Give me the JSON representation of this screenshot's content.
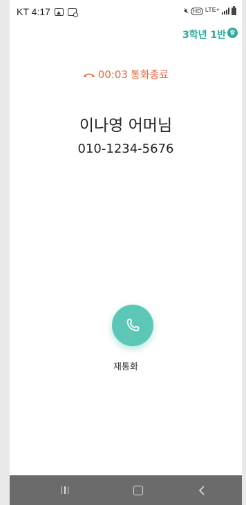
{
  "status_bar": {
    "carrier_time": "KT 4:17",
    "network": "LTE+"
  },
  "class_label": {
    "text": "3학년 1반",
    "badge": "랑"
  },
  "call": {
    "duration": "00:03",
    "status_text": "통화종료",
    "caller_name": "이나영 어머님",
    "caller_number": "010-1234-5676"
  },
  "actions": {
    "redial_label": "재통화"
  },
  "colors": {
    "accent_teal": "#5cc7b6",
    "class_text": "#2aa99b",
    "call_ended": "#e26a45",
    "nav_bar": "#6b6b6b"
  },
  "icons": {
    "gallery": "gallery-icon",
    "screenshot": "screenshot-icon",
    "mute": "mute-icon",
    "signal": "signal-icon",
    "battery": "battery-icon",
    "hangup": "hangup-icon",
    "phone": "phone-icon",
    "recent_apps": "recent-apps-icon",
    "home": "home-icon",
    "back": "back-icon"
  }
}
